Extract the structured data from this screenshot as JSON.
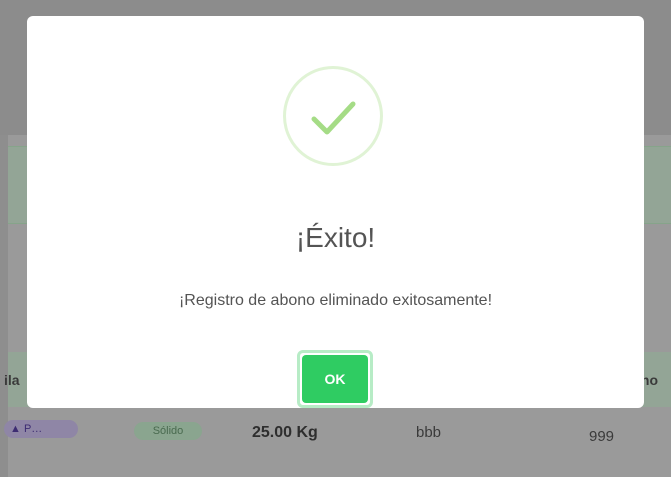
{
  "background": {
    "table_header_left_fragment": "ila",
    "table_header_right_fragment": "ino",
    "row": {
      "badge_purple": "▲ P…",
      "badge_green": "Sólido",
      "weight": "25.00 Kg",
      "text": "bbb",
      "number": "999"
    }
  },
  "dialog": {
    "icon": "success-check-icon",
    "title": "¡Éxito!",
    "message": "¡Registro de abono eliminado exitosamente!",
    "ok_label": "OK"
  },
  "colors": {
    "ok_button": "#2fcc62",
    "check": "#a5dc86"
  }
}
